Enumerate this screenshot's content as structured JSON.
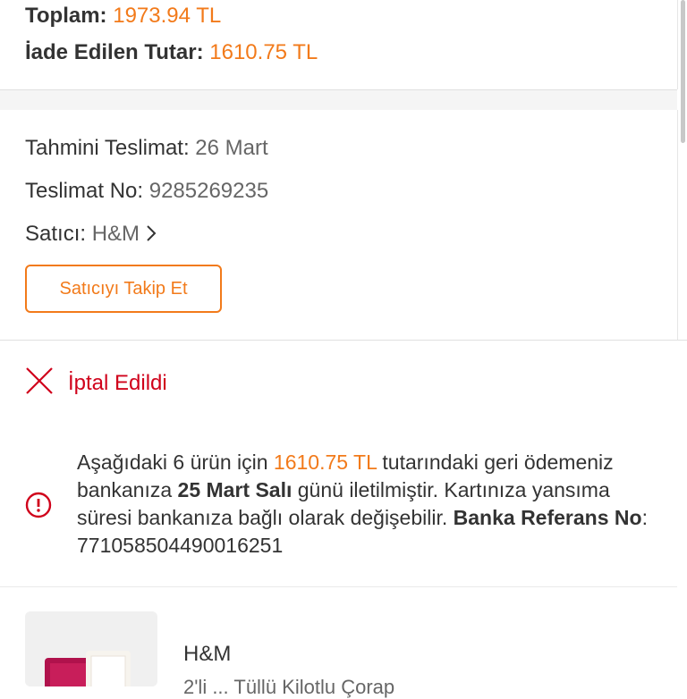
{
  "summary": {
    "total_label": "Toplam:",
    "total_value": "1973.94 TL",
    "refund_label": "İade Edilen Tutar:",
    "refund_value": "1610.75 TL"
  },
  "delivery": {
    "estimated_label": "Tahmini Teslimat:",
    "estimated_value": "26 Mart",
    "delivery_no_label": "Teslimat No:",
    "delivery_no_value": "9285269235",
    "seller_label": "Satıcı:",
    "seller_value": "H&M",
    "follow_button": "Satıcıyı Takip Et"
  },
  "status": {
    "text": "İptal Edildi",
    "color": "#d0021b"
  },
  "refund_info": {
    "part1": "Aşağıdaki 6 ürün için ",
    "amount": "1610.75 TL",
    "part2": " tutarındaki geri ödemeniz bankanıza ",
    "date": "25 Mart Salı",
    "part3": " günü iletilmiştir. Kartınıza yansıma süresi bankanıza bağlı olarak değişebilir. ",
    "ref_label": "Banka Referans No",
    "ref_value": ": 771058504490016251"
  },
  "product": {
    "brand": "H&M",
    "name": "2'li ... Tüllü Kilotlu Çorap"
  },
  "colors": {
    "accent": "#f27a1a",
    "danger": "#d0021b"
  }
}
